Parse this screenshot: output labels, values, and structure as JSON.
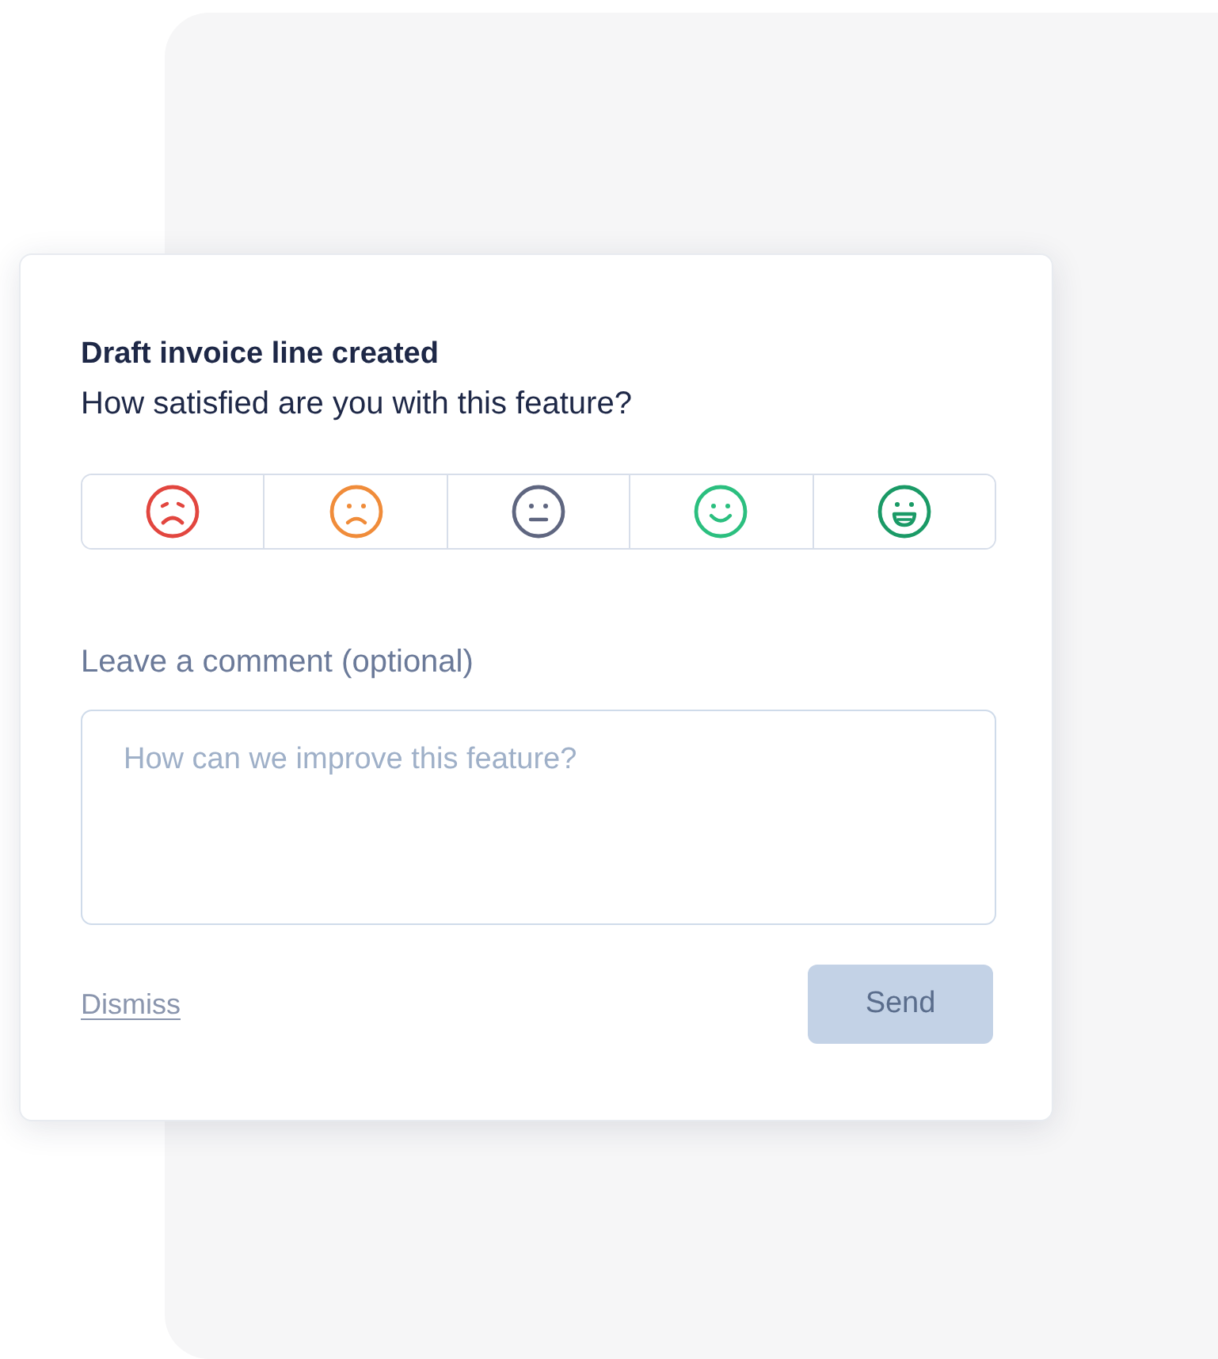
{
  "feedback": {
    "title": "Draft invoice line created",
    "question": "How satisfied are you with this feature?",
    "ratings": [
      {
        "kind": "very-sad",
        "color": "#e2463f",
        "selected": false
      },
      {
        "kind": "sad",
        "color": "#f08c3a",
        "selected": false
      },
      {
        "kind": "neutral",
        "color": "#5f6680",
        "selected": false
      },
      {
        "kind": "happy",
        "color": "#2bbf7f",
        "selected": false
      },
      {
        "kind": "very-happy",
        "color": "#1a9a66",
        "selected": false
      }
    ],
    "comment_label": "Leave a comment (optional)",
    "comment": {
      "placeholder": "How can we improve this feature?"
    },
    "dismiss": "Dismiss",
    "send": {
      "label": "Send",
      "disabled": true
    }
  }
}
